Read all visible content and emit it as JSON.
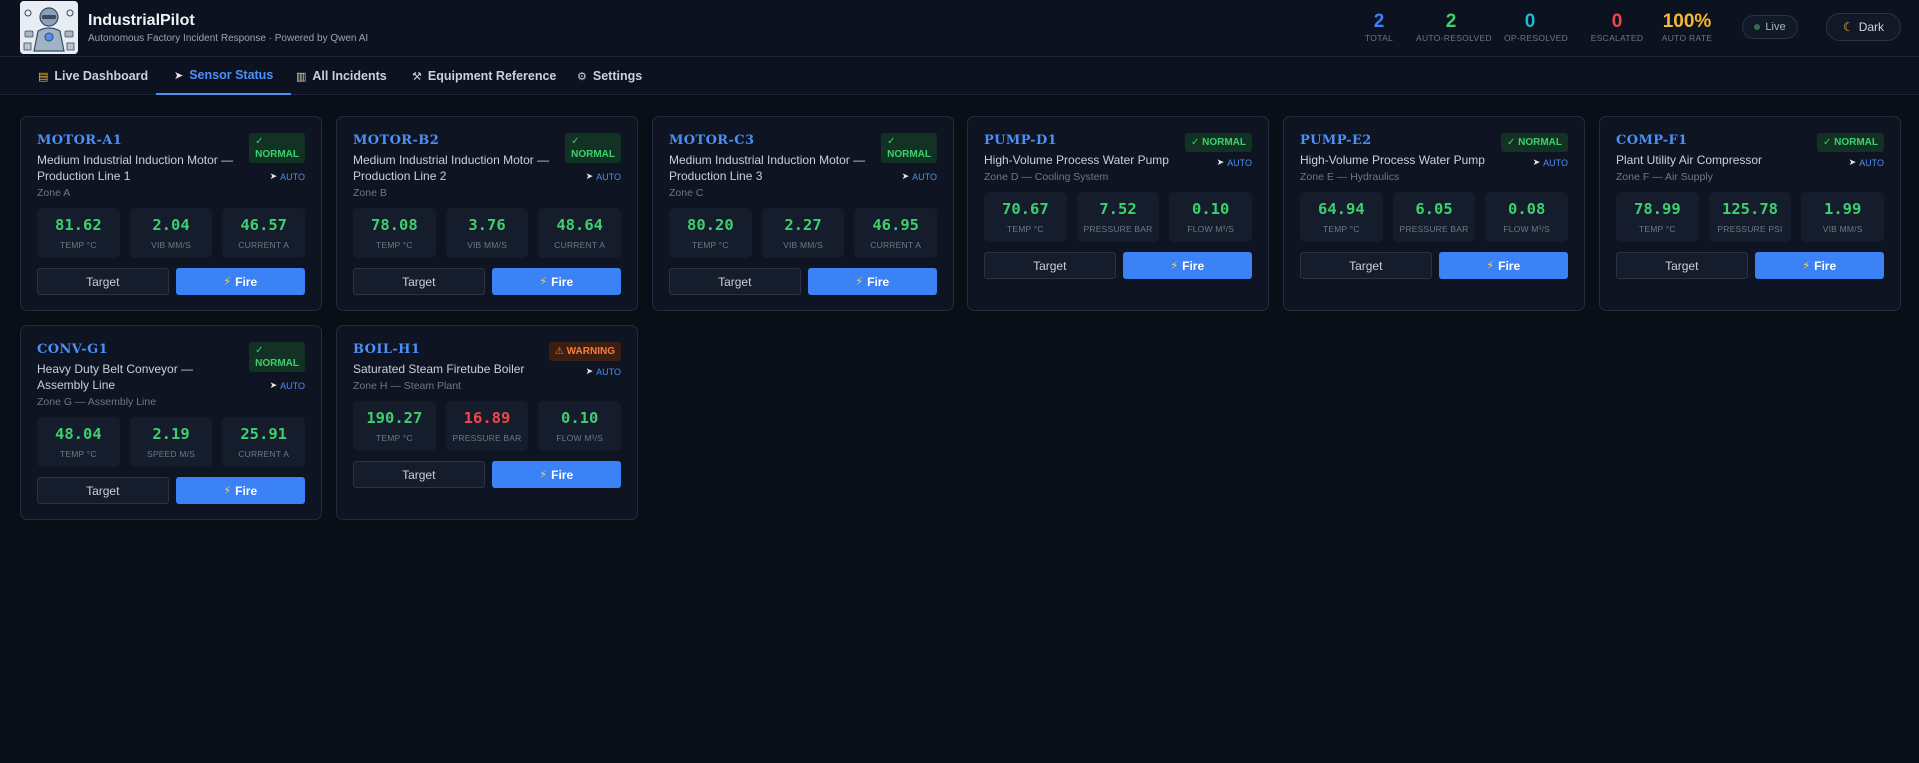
{
  "app": {
    "title": "IndustrialPilot",
    "subtitle": "Autonomous Factory Incident Response · Powered by Qwen AI"
  },
  "stats": [
    {
      "value": "2",
      "label": "TOTAL",
      "color": "#3b82f6"
    },
    {
      "value": "2",
      "label": "AUTO-RESOLVED",
      "color": "#3ecf6e"
    },
    {
      "value": "0",
      "label": "OP-RESOLVED",
      "color": "#22b8cf"
    },
    {
      "value": "0",
      "label": "ESCALATED",
      "color": "#f04848"
    },
    {
      "value": "100%",
      "label": "AUTO RATE",
      "color": "#f5b82e"
    }
  ],
  "live_label": "Live",
  "theme_label": "Dark",
  "tabs": [
    {
      "label": "Live Dashboard",
      "icon": "chart-icon"
    },
    {
      "label": "Sensor Status",
      "icon": "cursor-icon",
      "active": true
    },
    {
      "label": "All Incidents",
      "icon": "clipboard-icon"
    },
    {
      "label": "Equipment Reference",
      "icon": "wrench-icon"
    },
    {
      "label": "Settings",
      "icon": "gear-icon"
    }
  ],
  "buttons": {
    "target": "Target",
    "fire": "Fire"
  },
  "auto_label": "AUTO",
  "equipment": [
    {
      "id": "MOTOR-A1",
      "description": "Medium Industrial Induction Motor — Production Line 1",
      "zone": "Zone A",
      "status": "NORMAL",
      "status_symbol": "✓",
      "metrics": [
        {
          "value": "81.62",
          "unit": "TEMP °C"
        },
        {
          "value": "2.04",
          "unit": "VIB MM/S"
        },
        {
          "value": "46.57",
          "unit": "CURRENT A"
        }
      ]
    },
    {
      "id": "MOTOR-B2",
      "description": "Medium Industrial Induction Motor — Production Line 2",
      "zone": "Zone B",
      "status": "NORMAL",
      "status_symbol": "✓",
      "metrics": [
        {
          "value": "78.08",
          "unit": "TEMP °C"
        },
        {
          "value": "3.76",
          "unit": "VIB MM/S"
        },
        {
          "value": "48.64",
          "unit": "CURRENT A"
        }
      ]
    },
    {
      "id": "MOTOR-C3",
      "description": "Medium Industrial Induction Motor — Production Line 3",
      "zone": "Zone C",
      "status": "NORMAL",
      "status_symbol": "✓",
      "metrics": [
        {
          "value": "80.20",
          "unit": "TEMP °C"
        },
        {
          "value": "2.27",
          "unit": "VIB MM/S"
        },
        {
          "value": "46.95",
          "unit": "CURRENT A"
        }
      ]
    },
    {
      "id": "PUMP-D1",
      "description": "High-Volume Process Water Pump",
      "zone": "Zone D — Cooling System",
      "status": "NORMAL",
      "status_symbol": "✓",
      "metrics": [
        {
          "value": "70.67",
          "unit": "TEMP °C"
        },
        {
          "value": "7.52",
          "unit": "PRESSURE BAR"
        },
        {
          "value": "0.10",
          "unit": "FLOW M³/S"
        }
      ]
    },
    {
      "id": "PUMP-E2",
      "description": "High-Volume Process Water Pump",
      "zone": "Zone E — Hydraulics",
      "status": "NORMAL",
      "status_symbol": "✓",
      "metrics": [
        {
          "value": "64.94",
          "unit": "TEMP °C"
        },
        {
          "value": "6.05",
          "unit": "PRESSURE BAR"
        },
        {
          "value": "0.08",
          "unit": "FLOW M³/S"
        }
      ]
    },
    {
      "id": "COMP-F1",
      "description": "Plant Utility Air Compressor",
      "zone": "Zone F — Air Supply",
      "status": "NORMAL",
      "status_symbol": "✓",
      "metrics": [
        {
          "value": "78.99",
          "unit": "TEMP °C"
        },
        {
          "value": "125.78",
          "unit": "PRESSURE PSI"
        },
        {
          "value": "1.99",
          "unit": "VIB MM/S"
        }
      ]
    },
    {
      "id": "CONV-G1",
      "description": "Heavy Duty Belt Conveyor — Assembly Line",
      "zone": "Zone G — Assembly Line",
      "status": "NORMAL",
      "status_symbol": "✓",
      "metrics": [
        {
          "value": "48.04",
          "unit": "TEMP °C"
        },
        {
          "value": "2.19",
          "unit": "SPEED M/S"
        },
        {
          "value": "25.91",
          "unit": "CURRENT A"
        }
      ]
    },
    {
      "id": "BOIL-H1",
      "description": "Saturated Steam Firetube Boiler",
      "zone": "Zone H — Steam Plant",
      "status": "WARNING",
      "status_symbol": "⚠",
      "metrics": [
        {
          "value": "190.27",
          "unit": "TEMP °C"
        },
        {
          "value": "16.89",
          "unit": "PRESSURE BAR",
          "alert": true
        },
        {
          "value": "0.10",
          "unit": "FLOW M³/S"
        }
      ]
    }
  ]
}
